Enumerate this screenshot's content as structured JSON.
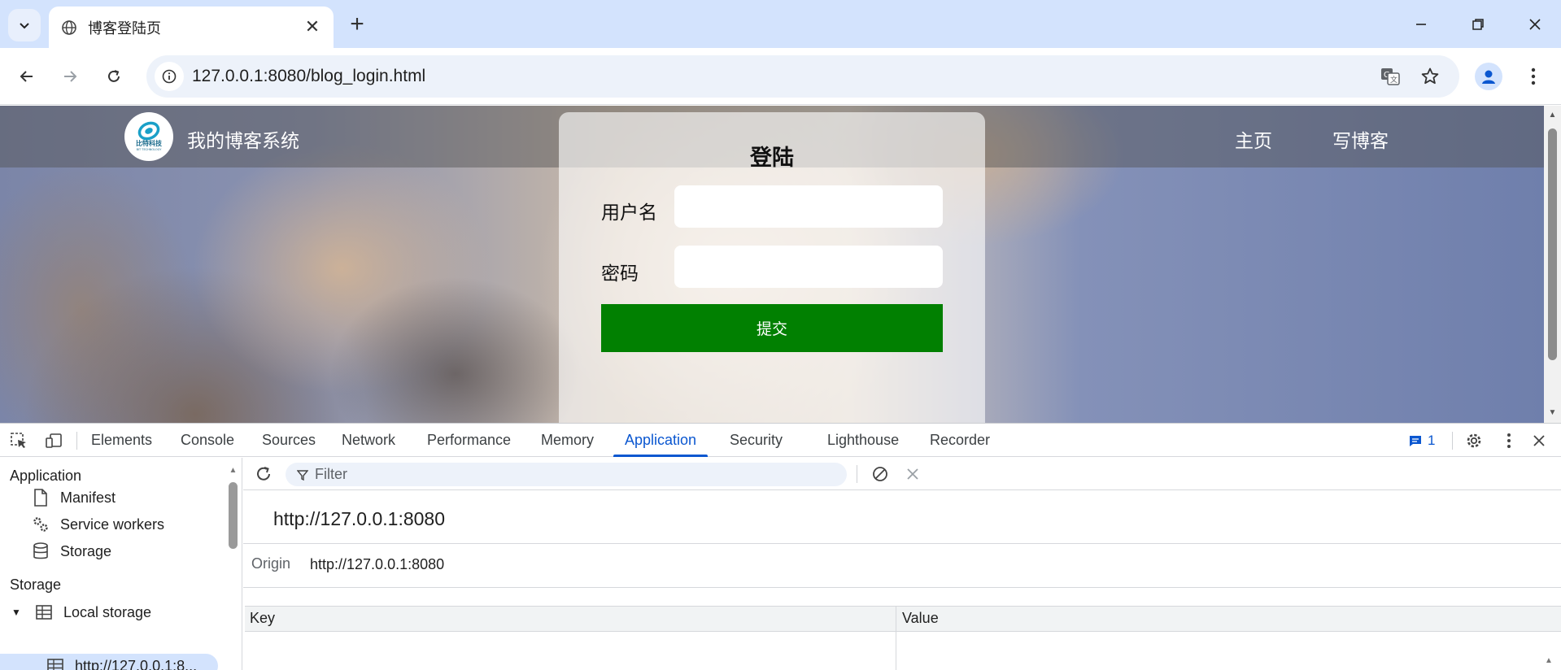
{
  "browser": {
    "tab": {
      "title": "博客登陆页",
      "close_glyph": "✕"
    },
    "new_tab_glyph": "+",
    "window_controls": {
      "minimize": "—",
      "maximize": "❐",
      "close": "✕"
    },
    "url": "127.0.0.1:8080/blog_login.html",
    "icons": [
      "tab-search-icon",
      "globe-icon",
      "back-icon",
      "forward-icon",
      "reload-icon",
      "site-info-icon",
      "translate-icon",
      "bookmark-star-icon",
      "profile-icon",
      "kebab-menu-icon"
    ]
  },
  "page": {
    "nav": {
      "brand": "我的博客系统",
      "logo_text": "比特科技",
      "links": [
        "主页",
        "写博客"
      ]
    },
    "login": {
      "heading": "登陆",
      "username_label": "用户名",
      "username_value": "",
      "password_label": "密码",
      "password_value": "",
      "submit_label": "提交",
      "submit_color": "#018001"
    }
  },
  "devtools": {
    "tabs": [
      "Elements",
      "Console",
      "Sources",
      "Network",
      "Performance",
      "Memory",
      "Application",
      "Security",
      "Lighthouse",
      "Recorder"
    ],
    "active_tab": "Application",
    "issues_count": "1",
    "sidebar": {
      "application_heading": "Application",
      "application_items": [
        "Manifest",
        "Service workers",
        "Storage"
      ],
      "storage_heading": "Storage",
      "local_storage_label": "Local storage",
      "selected_origin": "http://127.0.0.1:8..."
    },
    "filter_placeholder": "Filter",
    "origin_title": "http://127.0.0.1:8080",
    "origin_label": "Origin",
    "origin_value": "http://127.0.0.1:8080",
    "table": {
      "key_header": "Key",
      "value_header": "Value",
      "rows": []
    },
    "accent": "#0b57d0"
  }
}
